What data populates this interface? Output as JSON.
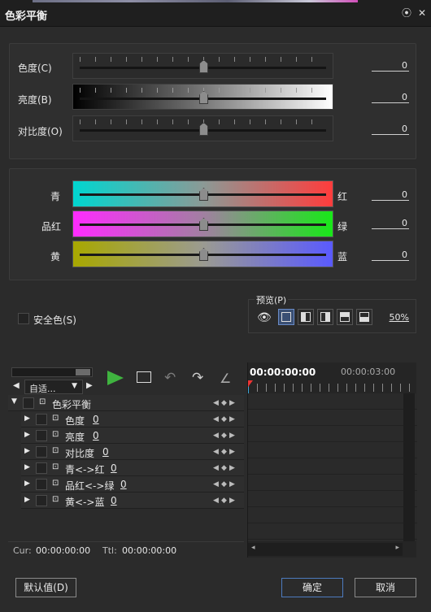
{
  "window": {
    "title": "色彩平衡"
  },
  "adjust": {
    "rows": [
      {
        "label": "色度(C)",
        "value": "0"
      },
      {
        "label": "亮度(B)",
        "value": "0"
      },
      {
        "label": "对比度(O)",
        "value": "0"
      }
    ]
  },
  "balance": {
    "rows": [
      {
        "left": "青",
        "right": "红",
        "value": "0"
      },
      {
        "left": "品红",
        "right": "绿",
        "value": "0"
      },
      {
        "left": "黄",
        "right": "蓝",
        "value": "0"
      }
    ]
  },
  "safe_color": {
    "label": "安全色(S)"
  },
  "preview": {
    "label": "预览(P)",
    "zoom": "50%"
  },
  "timeline": {
    "dropdown": "自适...",
    "timecode_start": "00:00:00:00",
    "timecode_mark": "00:00:03:00",
    "group_label": "色彩平衡",
    "tracks": [
      {
        "label": "色度",
        "value": "0"
      },
      {
        "label": "亮度",
        "value": "0"
      },
      {
        "label": "对比度",
        "value": "0"
      },
      {
        "label": "青<->红",
        "value": "0"
      },
      {
        "label": "品红<->绿",
        "value": "0"
      },
      {
        "label": "黄<->蓝",
        "value": "0"
      }
    ],
    "cur_label": "Cur:",
    "cur_value": "00:00:00:00",
    "ttl_label": "Ttl:",
    "ttl_value": "00:00:00:00"
  },
  "buttons": {
    "default": "默认值(D)",
    "ok": "确定",
    "cancel": "取消"
  },
  "colors": {
    "accent": "#4d7bbf",
    "play": "#3fb33f"
  }
}
